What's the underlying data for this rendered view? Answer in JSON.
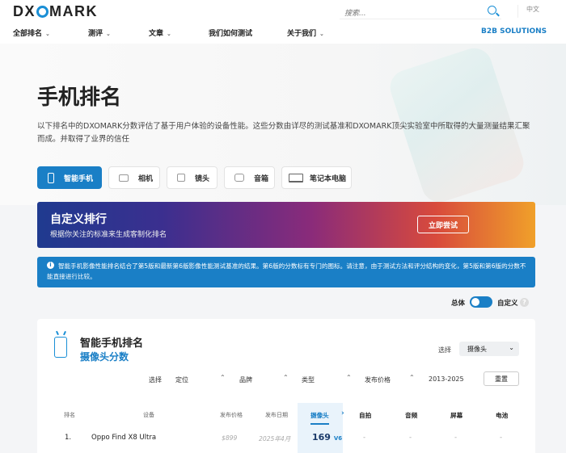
{
  "header": {
    "logo_pre": "DX",
    "logo_post": "MARK",
    "search_placeholder": "搜索...",
    "language": "中文",
    "nav": [
      {
        "label": "全部排名"
      },
      {
        "label": "测评"
      },
      {
        "label": "文章"
      },
      {
        "label": "我们如何测试"
      },
      {
        "label": "关于我们"
      }
    ],
    "b2b": "B2B SOLUTIONS",
    "chev": "⌄"
  },
  "hero": {
    "title": "手机排名",
    "intro": "以下排名中的DXOMARK分数评估了基于用户体验的设备性能。这些分数由详尽的测试基准和DXOMARK顶尖实验室中所取得的大量测量结果汇聚而成。并取得了业界的信任"
  },
  "tabs": [
    {
      "label": "智能手机",
      "icon": "smartphone-icon"
    },
    {
      "label": "相机",
      "icon": "camera-icon"
    },
    {
      "label": "镜头",
      "icon": "lens-icon"
    },
    {
      "label": "音箱",
      "icon": "speaker-icon"
    },
    {
      "label": "笔记本电脑",
      "icon": "laptop-icon"
    }
  ],
  "banner": {
    "title": "自定义排行",
    "subtitle": "根据你关注的标准来生成客制化排名",
    "button": "立即尝试"
  },
  "notice": {
    "icon": "i",
    "text": "智能手机影像性能排名结合了第5版和最新第6版影像性能测试基准的结果。第6版的分数标有专门的图标。请注意，由于测试方法和评分结构的变化，第5版和第6版的分数不能直接进行比较。"
  },
  "toggle": {
    "left": "总体",
    "right": "自定义",
    "help": "?"
  },
  "ranking": {
    "title": "智能手机排名",
    "subtitle": "摄像头分数",
    "select_label": "选择",
    "select_value": "摄像头",
    "filters": {
      "label": "选择",
      "items": [
        "定位",
        "品牌",
        "类型",
        "发布价格",
        "2013-2025"
      ],
      "reset": "重置",
      "up": "⌃"
    },
    "columns": [
      "排名",
      "设备",
      "发布价格",
      "发布日期",
      "摄像头",
      "自拍",
      "音频",
      "屏幕",
      "电池"
    ],
    "next_arrow": "›",
    "rows": [
      {
        "rank": "1.",
        "device": "Oppo Find X8 Ultra",
        "price": "$899",
        "date": "2025年4月",
        "camera": "169",
        "version": "V6",
        "selfie": "-",
        "audio": "-",
        "display": "-",
        "battery": "-"
      }
    ]
  }
}
